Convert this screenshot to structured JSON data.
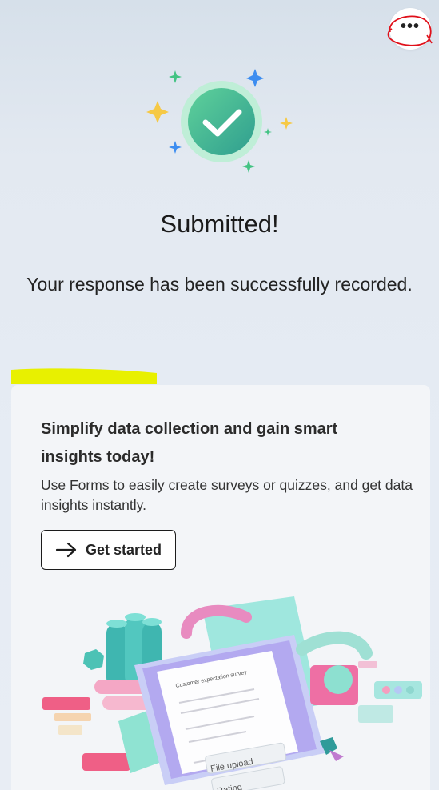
{
  "header": {
    "more_options_label": "•••",
    "icon": "more-horizontal-icon"
  },
  "confirmation": {
    "icon": "checkmark-circle-icon",
    "title": "Submitted!",
    "message": "Your response has been successfully recorded."
  },
  "promo": {
    "title": "Simplify data collection and gain smart insights today!",
    "description": "Use Forms to easily create surveys or quizzes, and get data insights instantly.",
    "button_label": "Get started",
    "button_icon": "arrow-right-icon"
  },
  "illustration": {
    "survey_title": "Customer expectation survey",
    "chip_file_upload": "File upload",
    "chip_rating": "Rating"
  },
  "colors": {
    "check_green": "#3fb98d",
    "annotation_red": "#e0101a",
    "annotation_yellow": "#e8f000"
  }
}
